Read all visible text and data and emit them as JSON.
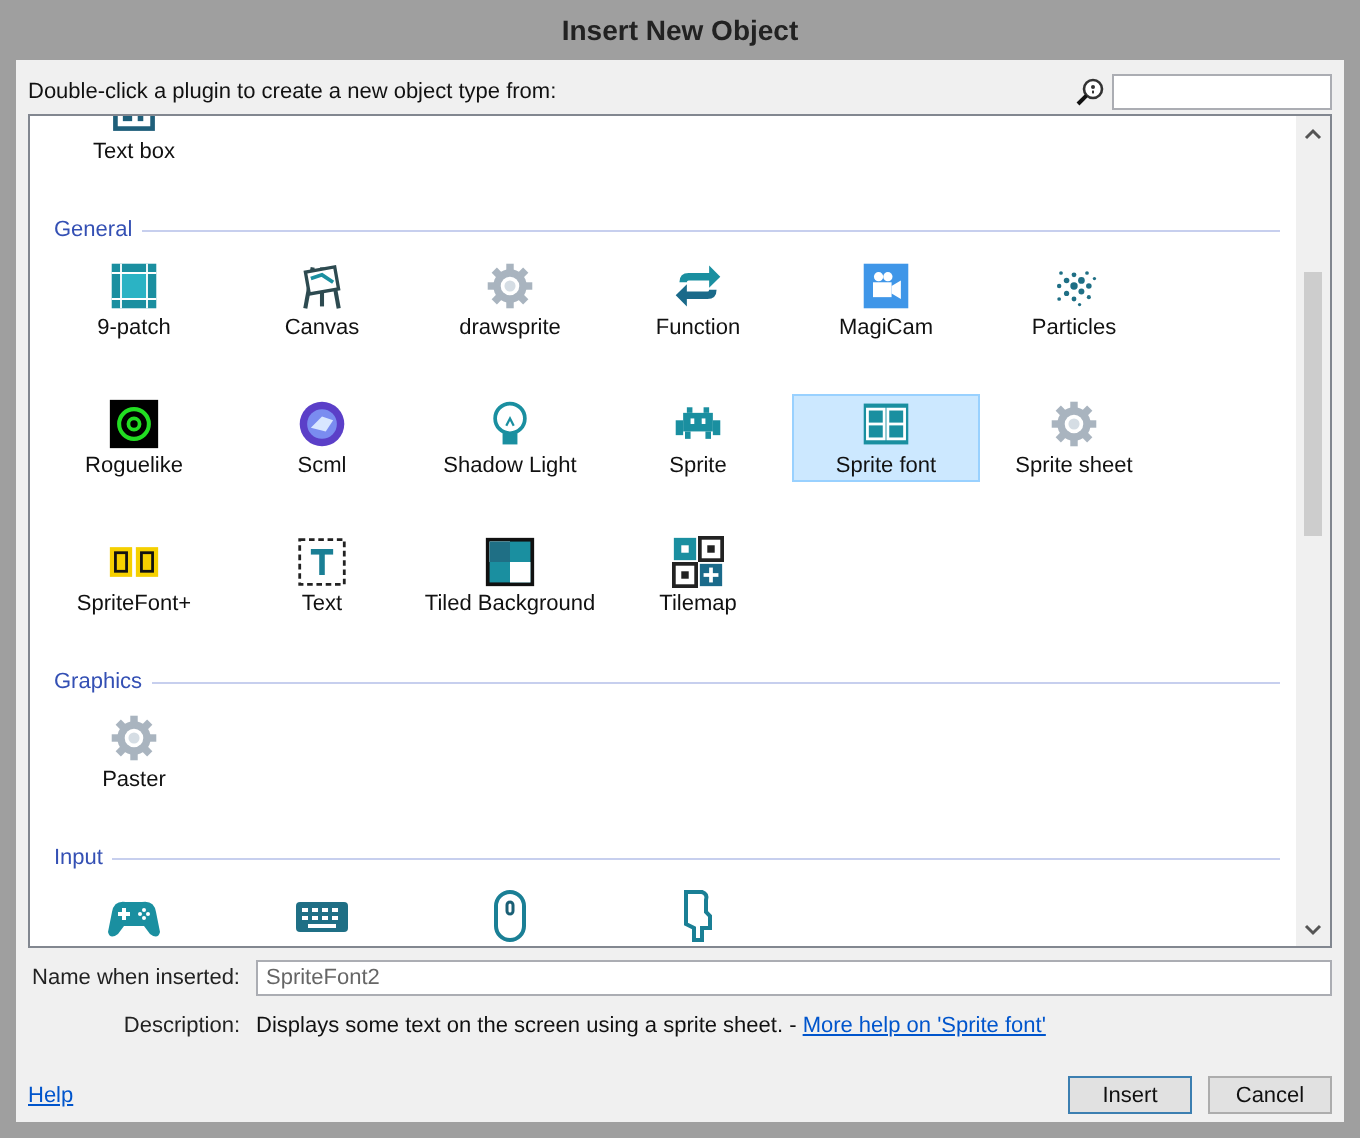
{
  "window": {
    "title": "Insert New Object"
  },
  "instruction": "Double-click a plugin to create a new object type from:",
  "sections": [
    {
      "items": [
        {
          "label": "Text box",
          "selected": false
        }
      ]
    },
    {
      "header": "General",
      "items": [
        {
          "label": "9-patch",
          "selected": false
        },
        {
          "label": "Canvas",
          "selected": false
        },
        {
          "label": "drawsprite",
          "selected": false
        },
        {
          "label": "Function",
          "selected": false
        },
        {
          "label": "MagiCam",
          "selected": false
        },
        {
          "label": "Particles",
          "selected": false
        },
        {
          "label": "Roguelike",
          "selected": false
        },
        {
          "label": "Scml",
          "selected": false
        },
        {
          "label": "Shadow Light",
          "selected": false
        },
        {
          "label": "Sprite",
          "selected": false
        },
        {
          "label": "Sprite font",
          "selected": true
        },
        {
          "label": "Sprite sheet",
          "selected": false
        },
        {
          "label": "SpriteFont+",
          "selected": false
        },
        {
          "label": "Text",
          "selected": false
        },
        {
          "label": "Tiled Background",
          "selected": false
        },
        {
          "label": "Tilemap",
          "selected": false
        }
      ]
    },
    {
      "header": "Graphics",
      "items": [
        {
          "label": "Paster",
          "selected": false
        }
      ]
    },
    {
      "header": "Input",
      "items": [
        {
          "selected": false
        },
        {
          "selected": false
        },
        {
          "selected": false
        },
        {
          "selected": false
        }
      ]
    }
  ],
  "name_field": {
    "label": "Name when inserted:",
    "value": "SpriteFont2"
  },
  "description": {
    "label": "Description:",
    "text": "Displays some text on the screen using a sprite sheet. - ",
    "link": "More help on 'Sprite font'"
  },
  "help_link": "Help",
  "buttons": [
    "Insert",
    "Cancel"
  ]
}
